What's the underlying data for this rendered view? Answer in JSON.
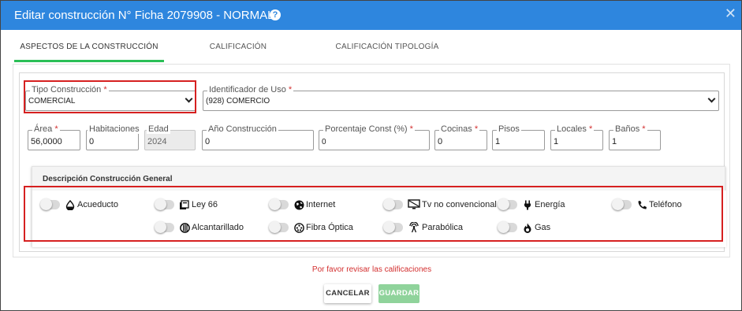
{
  "header": {
    "title": "Editar construcción N° Ficha 2079908 - NORMAL",
    "help_glyph": "?",
    "close_glyph": "✕",
    "bg_color": "#2e86de"
  },
  "tabs": [
    {
      "label": "ASPECTOS DE LA CONSTRUCCIÓN",
      "active": true
    },
    {
      "label": "CALIFICACIÓN",
      "active": false
    },
    {
      "label": "CALIFICACIÓN TIPOLOGÍA",
      "active": false
    }
  ],
  "form": {
    "tipo_construccion": {
      "label": "Tipo Construcción",
      "required": "*",
      "value": "COMERCIAL"
    },
    "identificador_uso": {
      "label": "Identificador de Uso",
      "required": "*",
      "value": "(928) COMERCIO"
    },
    "area": {
      "label": "Área",
      "required": "*",
      "value": "56,0000"
    },
    "habitaciones": {
      "label": "Habitaciones",
      "value": "0"
    },
    "edad": {
      "label": "Edad",
      "value": "2024"
    },
    "anio_construccion": {
      "label": "Año Construcción",
      "value": "0"
    },
    "porcentaje_const": {
      "label": "Porcentaje Const (%)",
      "required": "*",
      "value": "0"
    },
    "cocinas": {
      "label": "Cocinas",
      "required": "*",
      "value": "0"
    },
    "pisos": {
      "label": "Pisos",
      "value": "1"
    },
    "locales": {
      "label": "Locales",
      "required": "*",
      "value": "1"
    },
    "banos": {
      "label": "Baños",
      "required": "*",
      "value": "1"
    }
  },
  "description": {
    "title": "Descripción Construcción General",
    "services": [
      {
        "label": "Acueducto",
        "icon": "water-drop-icon",
        "on": false
      },
      {
        "label": "Ley 66",
        "icon": "book-icon",
        "on": false
      },
      {
        "label": "Internet",
        "icon": "globe-icon",
        "on": false
      },
      {
        "label": "Tv no convencional",
        "icon": "tv-icon",
        "on": false
      },
      {
        "label": "Energía",
        "icon": "plug-icon",
        "on": false
      },
      {
        "label": "Teléfono",
        "icon": "phone-icon",
        "on": false
      },
      {
        "label": "Alcantarillado",
        "icon": "sewer-icon",
        "on": false
      },
      {
        "label": "Fibra Óptica",
        "icon": "fiber-icon",
        "on": false
      },
      {
        "label": "Parabólica",
        "icon": "antenna-icon",
        "on": false
      },
      {
        "label": "Gas",
        "icon": "flame-icon",
        "on": false
      }
    ]
  },
  "footer": {
    "warning": "Por favor revisar las calificaciones",
    "cancel_label": "CANCELAR",
    "save_label": "GUARDAR"
  },
  "colors": {
    "highlight": "#d62020",
    "active_tab": "#2bbf57",
    "save_button": "#8fd39b",
    "warning": "#d32f2f"
  }
}
